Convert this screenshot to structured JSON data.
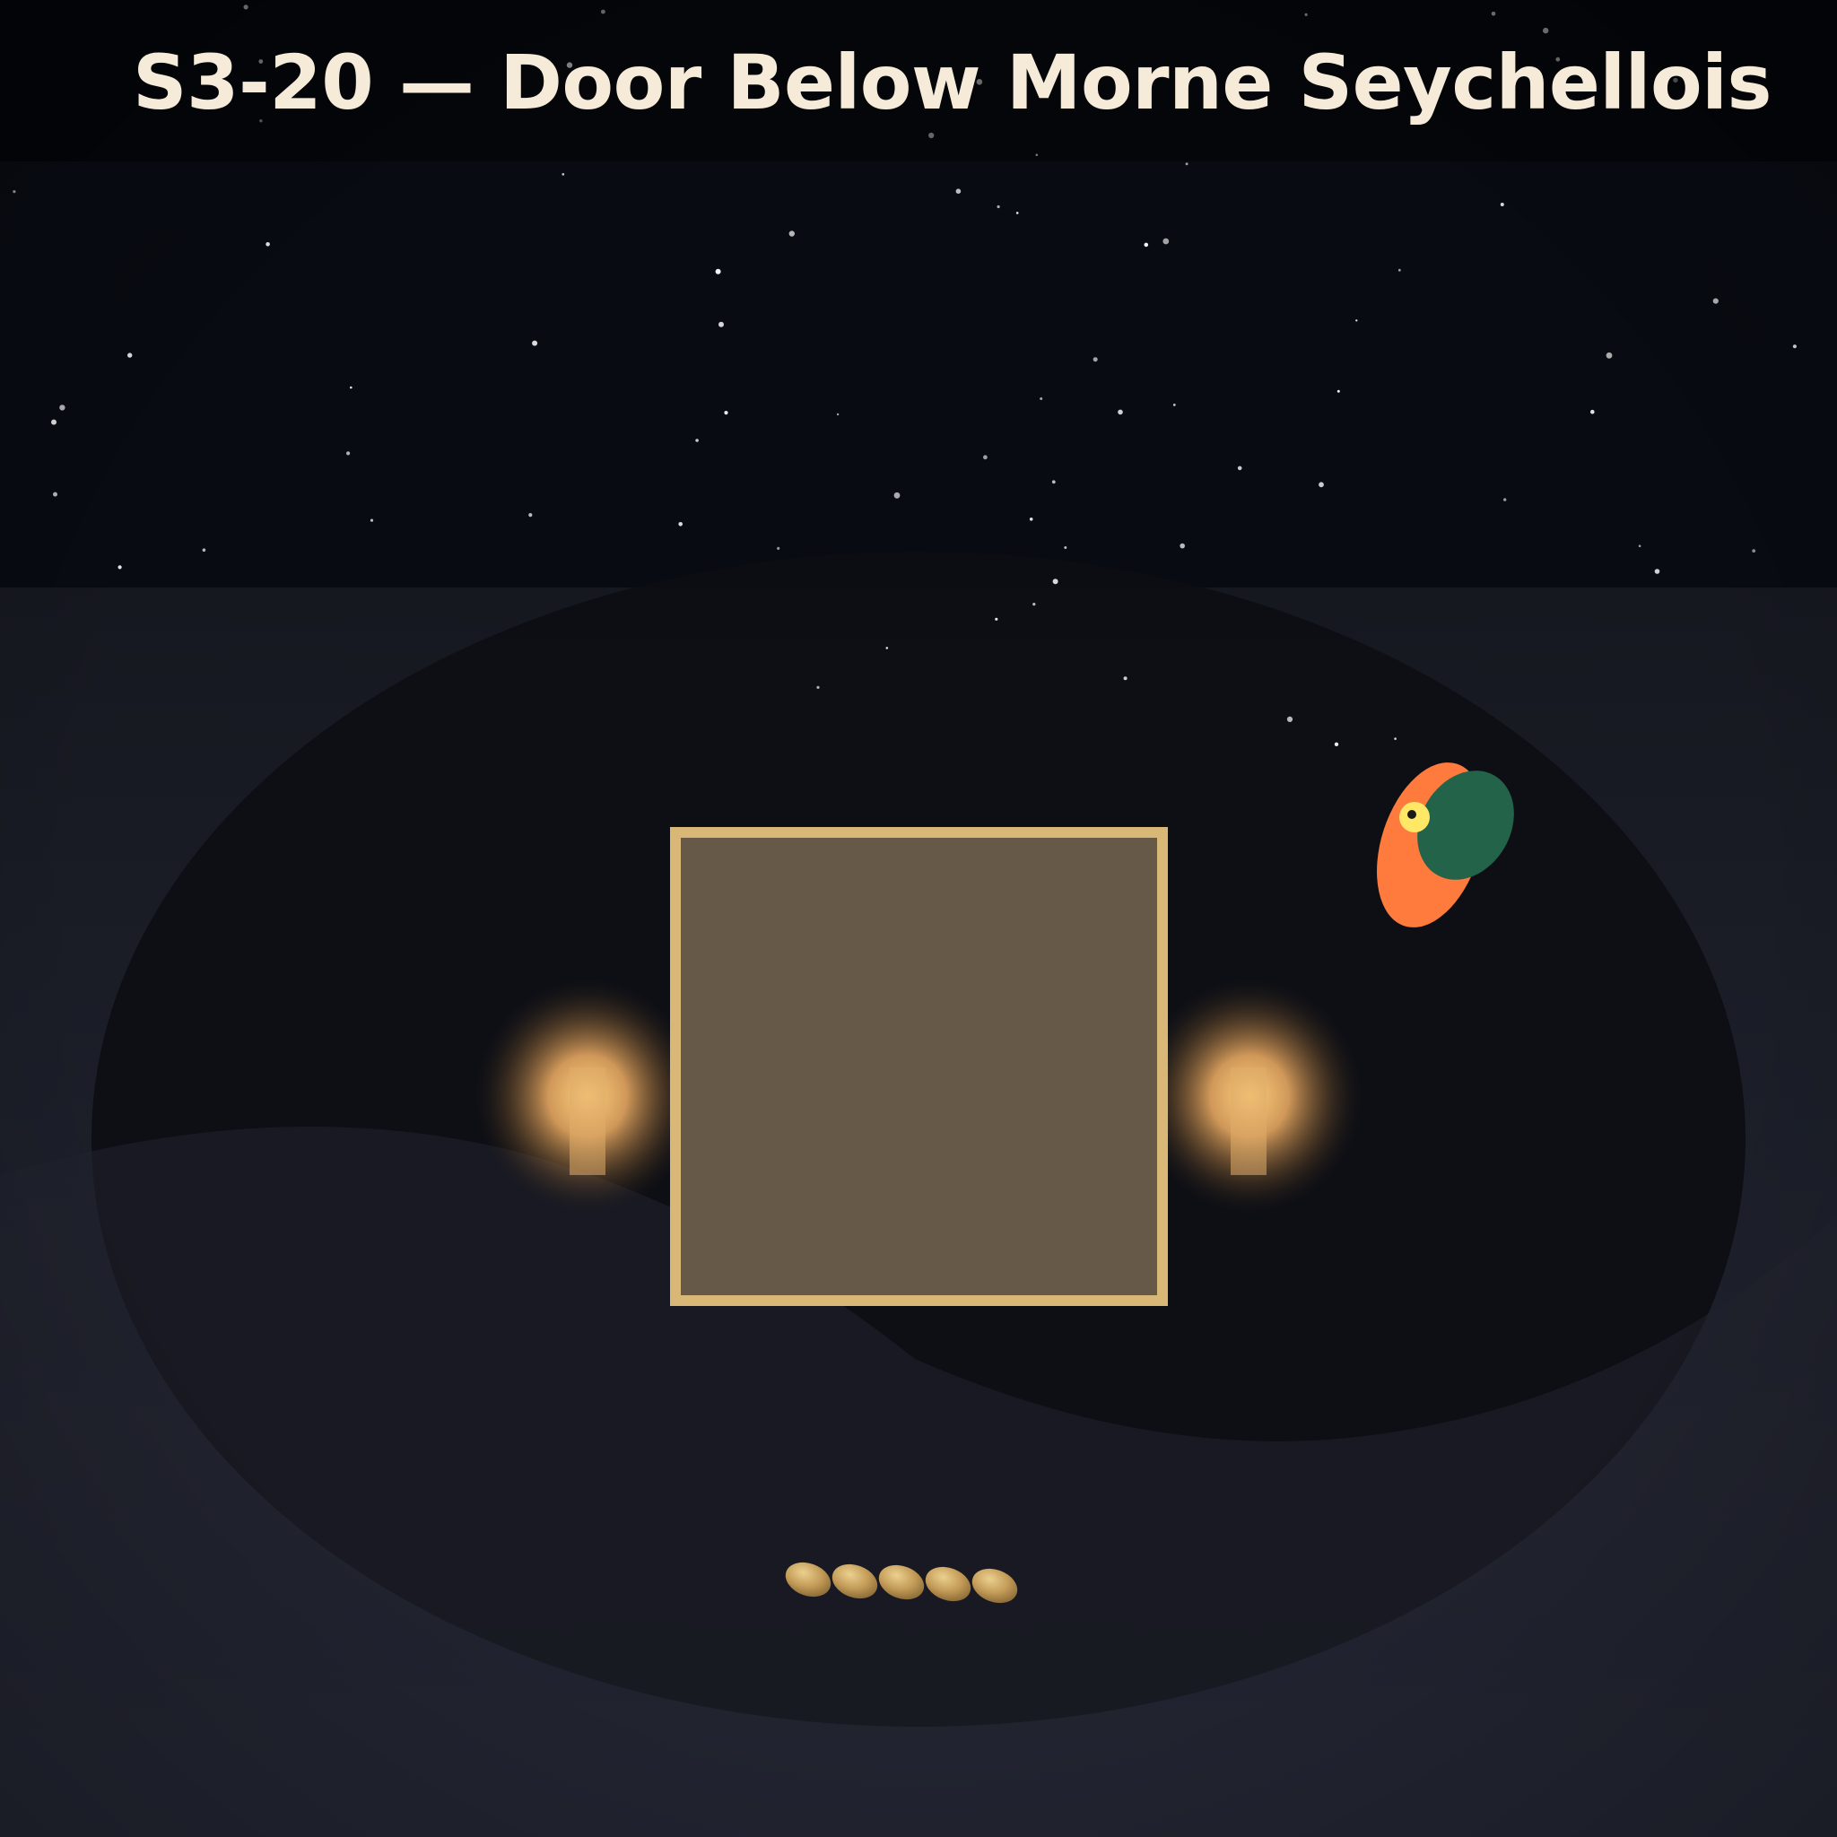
{
  "level": {
    "title": "S3-20 — Door Below Morne Seychellois"
  },
  "scene": {
    "sky_color": "#080b12",
    "cave_color": "#0d0e13",
    "ground_color": "#222633",
    "door_fill": "#665948",
    "door_frame": "#d9b877",
    "lantern_glow": "#ffcf80",
    "bird_body": "#ff7a3d",
    "bird_wing": "#23634a",
    "bird_eye": "#ffe866",
    "seed_color": "#c9a360",
    "lantern_count": 2,
    "seed_count": 5
  },
  "icons": {
    "door": "door-icon",
    "lantern": "lantern-icon",
    "bird": "bird-icon",
    "seed": "seed-icon"
  }
}
